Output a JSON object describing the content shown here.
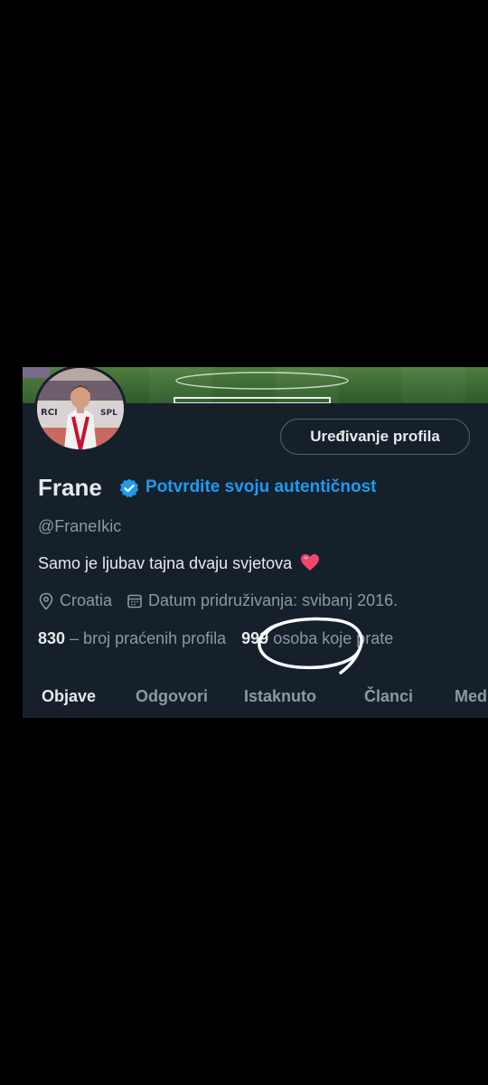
{
  "profile": {
    "edit_button": "Uređivanje profila",
    "name": "Frane",
    "verify_link": "Potvrdite svoju autentičnost",
    "handle": "@FraneIkic",
    "bio": "Samo je ljubav tajna dvaju svjetova",
    "location": "Croatia",
    "joined": "Datum pridruživanja: svibanj 2016.",
    "following_count": "830",
    "following_label": " – broj praćenih profila ",
    "followers_count": "999",
    "followers_label": " osoba koje prate"
  },
  "tabs": [
    "Objave",
    "Odgovori",
    "Istaknuto",
    "Članci",
    "Med"
  ],
  "icons": [
    "verified-badge-icon",
    "heart-emoji-icon",
    "location-pin-icon",
    "calendar-icon"
  ],
  "colors": {
    "background": "#15202b",
    "accent": "#1d9bf0",
    "text": "#e7e9ea",
    "muted": "#8b98a5",
    "annotation": "#ffffff"
  }
}
